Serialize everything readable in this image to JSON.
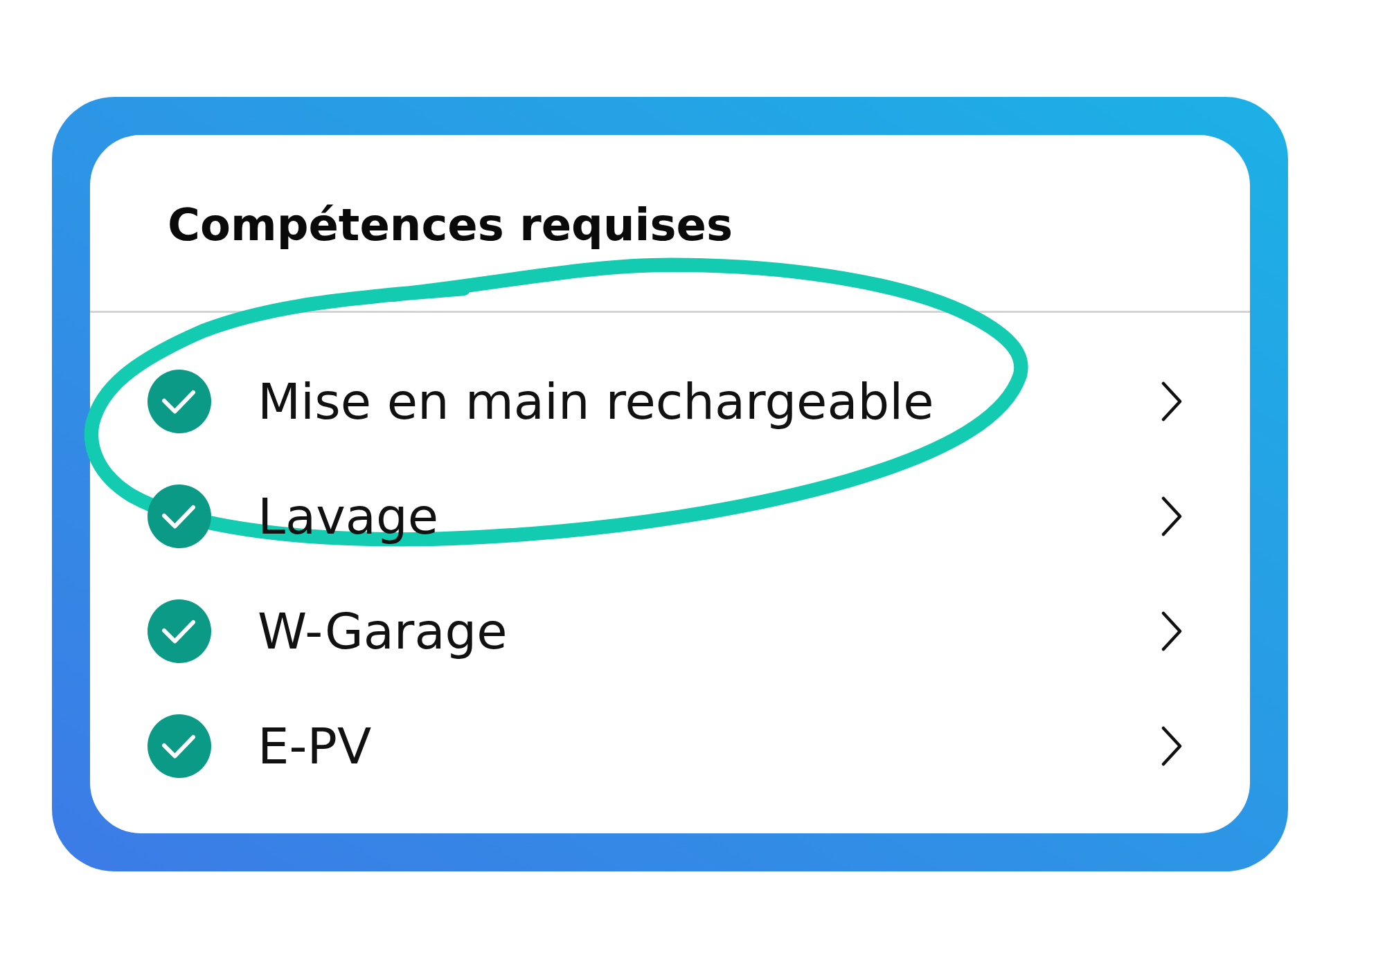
{
  "card": {
    "title": "Compétences requises",
    "skills": [
      {
        "name": "Mise en main rechargeable",
        "checked": true,
        "circled": true
      },
      {
        "name": "Lavage",
        "checked": true,
        "circled": false
      },
      {
        "name": "W-Garage",
        "checked": true,
        "circled": false
      },
      {
        "name": "E-PV",
        "checked": true,
        "circled": false
      }
    ]
  }
}
